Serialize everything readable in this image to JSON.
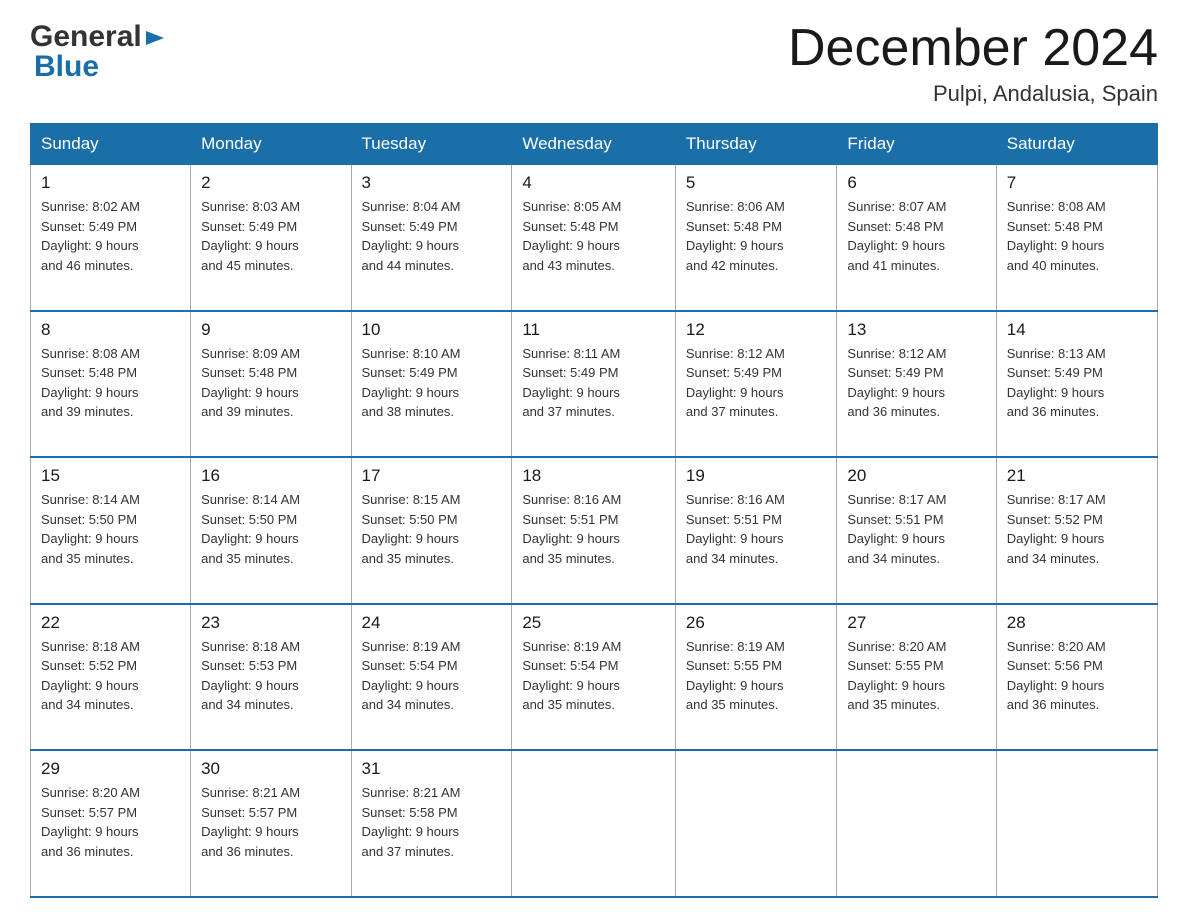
{
  "header": {
    "logo_general": "General",
    "logo_blue": "Blue",
    "month_title": "December 2024",
    "location": "Pulpi, Andalusia, Spain"
  },
  "weekdays": [
    "Sunday",
    "Monday",
    "Tuesday",
    "Wednesday",
    "Thursday",
    "Friday",
    "Saturday"
  ],
  "weeks": [
    [
      {
        "day": "1",
        "sunrise": "8:02 AM",
        "sunset": "5:49 PM",
        "daylight": "9 hours and 46 minutes."
      },
      {
        "day": "2",
        "sunrise": "8:03 AM",
        "sunset": "5:49 PM",
        "daylight": "9 hours and 45 minutes."
      },
      {
        "day": "3",
        "sunrise": "8:04 AM",
        "sunset": "5:49 PM",
        "daylight": "9 hours and 44 minutes."
      },
      {
        "day": "4",
        "sunrise": "8:05 AM",
        "sunset": "5:48 PM",
        "daylight": "9 hours and 43 minutes."
      },
      {
        "day": "5",
        "sunrise": "8:06 AM",
        "sunset": "5:48 PM",
        "daylight": "9 hours and 42 minutes."
      },
      {
        "day": "6",
        "sunrise": "8:07 AM",
        "sunset": "5:48 PM",
        "daylight": "9 hours and 41 minutes."
      },
      {
        "day": "7",
        "sunrise": "8:08 AM",
        "sunset": "5:48 PM",
        "daylight": "9 hours and 40 minutes."
      }
    ],
    [
      {
        "day": "8",
        "sunrise": "8:08 AM",
        "sunset": "5:48 PM",
        "daylight": "9 hours and 39 minutes."
      },
      {
        "day": "9",
        "sunrise": "8:09 AM",
        "sunset": "5:48 PM",
        "daylight": "9 hours and 39 minutes."
      },
      {
        "day": "10",
        "sunrise": "8:10 AM",
        "sunset": "5:49 PM",
        "daylight": "9 hours and 38 minutes."
      },
      {
        "day": "11",
        "sunrise": "8:11 AM",
        "sunset": "5:49 PM",
        "daylight": "9 hours and 37 minutes."
      },
      {
        "day": "12",
        "sunrise": "8:12 AM",
        "sunset": "5:49 PM",
        "daylight": "9 hours and 37 minutes."
      },
      {
        "day": "13",
        "sunrise": "8:12 AM",
        "sunset": "5:49 PM",
        "daylight": "9 hours and 36 minutes."
      },
      {
        "day": "14",
        "sunrise": "8:13 AM",
        "sunset": "5:49 PM",
        "daylight": "9 hours and 36 minutes."
      }
    ],
    [
      {
        "day": "15",
        "sunrise": "8:14 AM",
        "sunset": "5:50 PM",
        "daylight": "9 hours and 35 minutes."
      },
      {
        "day": "16",
        "sunrise": "8:14 AM",
        "sunset": "5:50 PM",
        "daylight": "9 hours and 35 minutes."
      },
      {
        "day": "17",
        "sunrise": "8:15 AM",
        "sunset": "5:50 PM",
        "daylight": "9 hours and 35 minutes."
      },
      {
        "day": "18",
        "sunrise": "8:16 AM",
        "sunset": "5:51 PM",
        "daylight": "9 hours and 35 minutes."
      },
      {
        "day": "19",
        "sunrise": "8:16 AM",
        "sunset": "5:51 PM",
        "daylight": "9 hours and 34 minutes."
      },
      {
        "day": "20",
        "sunrise": "8:17 AM",
        "sunset": "5:51 PM",
        "daylight": "9 hours and 34 minutes."
      },
      {
        "day": "21",
        "sunrise": "8:17 AM",
        "sunset": "5:52 PM",
        "daylight": "9 hours and 34 minutes."
      }
    ],
    [
      {
        "day": "22",
        "sunrise": "8:18 AM",
        "sunset": "5:52 PM",
        "daylight": "9 hours and 34 minutes."
      },
      {
        "day": "23",
        "sunrise": "8:18 AM",
        "sunset": "5:53 PM",
        "daylight": "9 hours and 34 minutes."
      },
      {
        "day": "24",
        "sunrise": "8:19 AM",
        "sunset": "5:54 PM",
        "daylight": "9 hours and 34 minutes."
      },
      {
        "day": "25",
        "sunrise": "8:19 AM",
        "sunset": "5:54 PM",
        "daylight": "9 hours and 35 minutes."
      },
      {
        "day": "26",
        "sunrise": "8:19 AM",
        "sunset": "5:55 PM",
        "daylight": "9 hours and 35 minutes."
      },
      {
        "day": "27",
        "sunrise": "8:20 AM",
        "sunset": "5:55 PM",
        "daylight": "9 hours and 35 minutes."
      },
      {
        "day": "28",
        "sunrise": "8:20 AM",
        "sunset": "5:56 PM",
        "daylight": "9 hours and 36 minutes."
      }
    ],
    [
      {
        "day": "29",
        "sunrise": "8:20 AM",
        "sunset": "5:57 PM",
        "daylight": "9 hours and 36 minutes."
      },
      {
        "day": "30",
        "sunrise": "8:21 AM",
        "sunset": "5:57 PM",
        "daylight": "9 hours and 36 minutes."
      },
      {
        "day": "31",
        "sunrise": "8:21 AM",
        "sunset": "5:58 PM",
        "daylight": "9 hours and 37 minutes."
      },
      null,
      null,
      null,
      null
    ]
  ],
  "labels": {
    "sunrise": "Sunrise:",
    "sunset": "Sunset:",
    "daylight": "Daylight:"
  },
  "colors": {
    "header_bg": "#1a6fa8",
    "header_text": "#ffffff",
    "border": "#aaaaaa",
    "accent": "#1a6fa8"
  }
}
